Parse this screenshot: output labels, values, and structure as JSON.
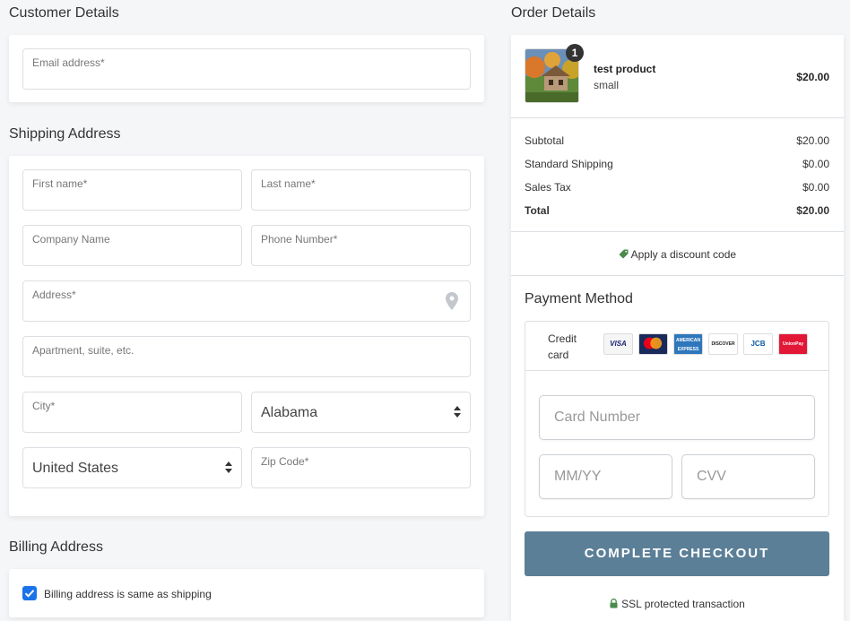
{
  "customer": {
    "title": "Customer Details",
    "email_label": "Email address*"
  },
  "shipping": {
    "title": "Shipping Address",
    "first_name": "First name*",
    "last_name": "Last name*",
    "company": "Company Name",
    "phone": "Phone Number*",
    "address": "Address*",
    "apartment": "Apartment, suite, etc.",
    "city": "City*",
    "state": "Alabama",
    "country": "United States",
    "zip": "Zip Code*"
  },
  "billing": {
    "title": "Billing Address",
    "same_as_shipping": "Billing address is same as shipping"
  },
  "order": {
    "title": "Order Details",
    "item": {
      "name": "test product",
      "variant": "small",
      "price": "$20.00",
      "quantity": "1"
    },
    "summary": [
      {
        "label": "Subtotal",
        "value": "$20.00"
      },
      {
        "label": "Standard Shipping",
        "value": "$0.00"
      },
      {
        "label": "Sales Tax",
        "value": "$0.00"
      },
      {
        "label": "Total",
        "value": "$20.00"
      }
    ],
    "discount_link": "Apply a discount code"
  },
  "payment": {
    "title": "Payment Method",
    "credit_card_label_1": "Credit",
    "credit_card_label_2": "card",
    "card_logos": [
      "VISA",
      "MasterCard",
      "AMERICAN EXPRESS",
      "DISCOVER",
      "JCB",
      "UnionPay"
    ],
    "card_number_placeholder": "Card Number",
    "expiry_placeholder": "MM/YY",
    "cvv_placeholder": "CVV",
    "checkout_button": "COMPLETE CHECKOUT",
    "ssl_text": "SSL protected transaction"
  },
  "colors": {
    "accent": "#5b7f97",
    "checkbox": "#1a73e8",
    "discount_tag": "#4a8a4a"
  }
}
